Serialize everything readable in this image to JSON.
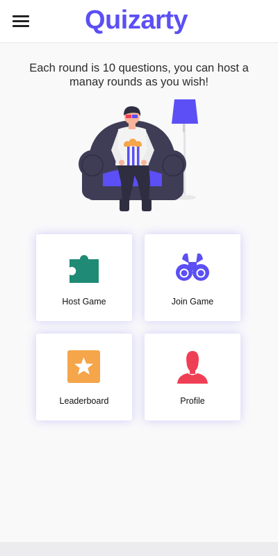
{
  "app": {
    "title": "Quizarty"
  },
  "header": {
    "menu_icon": "hamburger-menu-icon"
  },
  "intro": {
    "text": "Each round is 10 questions, you can host a manay rounds as you wish!"
  },
  "colors": {
    "brand": "#5b4ff5",
    "host": "#1f8a75",
    "join": "#5b4ff5",
    "leaderboard": "#f5a54a",
    "profile": "#ef3f55"
  },
  "menu": [
    {
      "label": "Host Game",
      "icon": "puzzle-piece-icon"
    },
    {
      "label": "Join Game",
      "icon": "binoculars-icon"
    },
    {
      "label": "Leaderboard",
      "icon": "star-badge-icon"
    },
    {
      "label": "Profile",
      "icon": "person-icon"
    }
  ]
}
